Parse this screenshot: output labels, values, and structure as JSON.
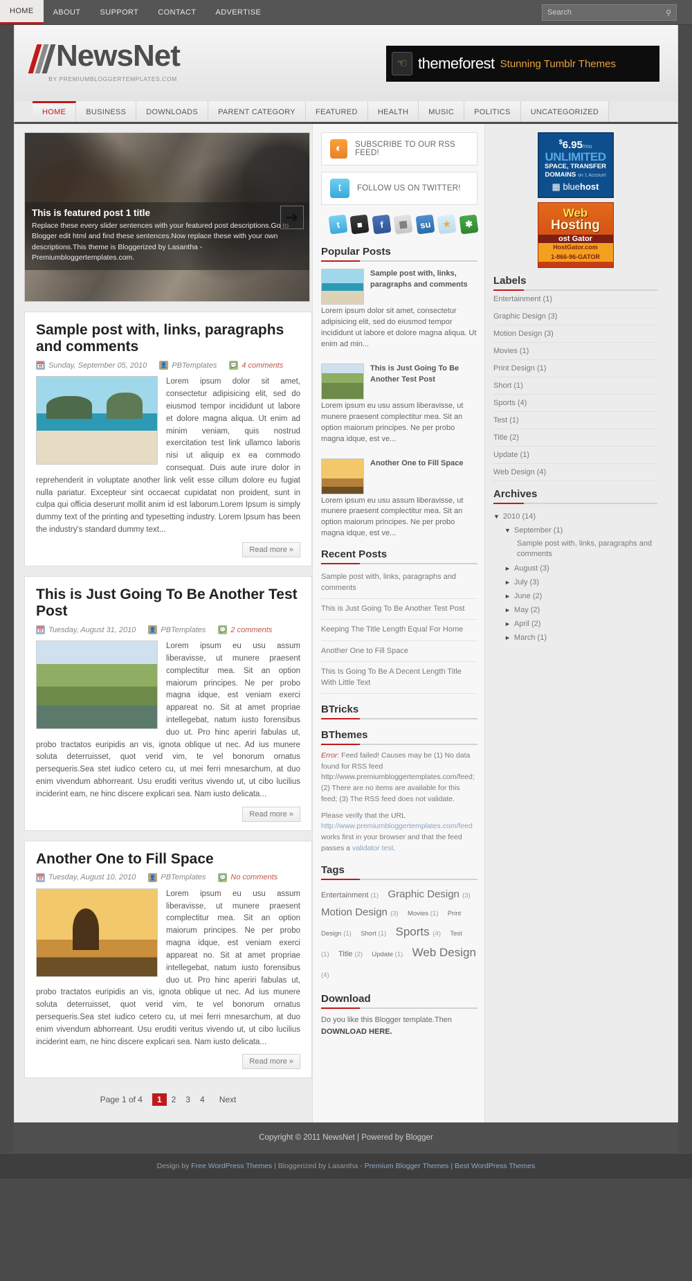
{
  "topbar": {
    "nav": [
      {
        "label": "HOME",
        "active": true
      },
      {
        "label": "ABOUT",
        "active": false
      },
      {
        "label": "SUPPORT",
        "active": false
      },
      {
        "label": "CONTACT",
        "active": false
      },
      {
        "label": "ADVERTISE",
        "active": false
      }
    ],
    "search_placeholder": "Search",
    "search_value": ""
  },
  "header": {
    "logo_name": "NewsNet",
    "logo_sub": "BY PREMIUMBLOGGERTEMPLATES.COM",
    "banner_text_1": "themeforest",
    "banner_text_2": "Stunning Tumblr Themes"
  },
  "catnav": [
    {
      "label": "HOME",
      "active": true
    },
    {
      "label": "BUSINESS",
      "active": false
    },
    {
      "label": "DOWNLOADS",
      "active": false
    },
    {
      "label": "PARENT CATEGORY",
      "active": false
    },
    {
      "label": "FEATURED",
      "active": false
    },
    {
      "label": "HEALTH",
      "active": false
    },
    {
      "label": "MUSIC",
      "active": false
    },
    {
      "label": "POLITICS",
      "active": false
    },
    {
      "label": "UNCATEGORIZED",
      "active": false
    }
  ],
  "slider": {
    "title": "This is featured post 1 title",
    "desc": "Replace these every slider sentences with your featured post descriptions.Go to Blogger edit html and find these sentences.Now replace these with your own descriptions.This theme is Bloggerized by Lasantha - Premiumbloggertemplates.com.",
    "next_label": "➔"
  },
  "posts": [
    {
      "title": "Sample post with, links, paragraphs and comments",
      "date": "Sunday, September 05, 2010",
      "author": "PBTemplates",
      "comments": "4 comments",
      "body": "Lorem ipsum dolor sit amet, consectetur adipisicing elit, sed do eiusmod tempor incididunt ut labore et dolore magna aliqua. Ut enim ad minim veniam, quis nostrud exercitation test link ullamco laboris nisi ut aliquip ex ea commodo consequat. Duis aute irure dolor in reprehenderit in voluptate another link velit esse cillum dolore eu fugiat nulla pariatur. Excepteur sint occaecat cupidatat non proident, sunt in culpa qui officia deserunt mollit anim id est laborum.Lorem Ipsum is simply dummy text of the printing and typesetting industry. Lorem Ipsum has been the industry's standard dummy text...",
      "readmore": "Read more »",
      "thumb_class": "beach"
    },
    {
      "title": "This is Just Going To Be Another Test Post",
      "date": "Tuesday, August 31, 2010",
      "author": "PBTemplates",
      "comments": "2 comments",
      "body": "Lorem ipsum eu usu assum liberavisse, ut munere praesent complectitur mea. Sit an option maiorum principes. Ne per probo magna idque, est veniam exerci appareat no. Sit at amet propriae intellegebat, natum iusto forensibus duo ut. Pro hinc aperiri fabulas ut, probo tractatos euripidis an vis, ignota oblique ut nec. Ad ius munere soluta deterruisset, quot verid vim, te vel bonorum ornatus persequeris.Sea stet iudico cetero cu, ut mei ferri mnesarchum, at duo enim vivendum abhorreant. Usu eruditi veritus vivendo ut, ut cibo lucilius inciderint eam, ne hinc discere explicari sea. Nam iusto delicata...",
      "readmore": "Read more »",
      "thumb_class": "horse"
    },
    {
      "title": "Another One to Fill Space",
      "date": "Tuesday, August 10, 2010",
      "author": "PBTemplates",
      "comments": "No comments",
      "body": "Lorem ipsum eu usu assum liberavisse, ut munere praesent complectitur mea. Sit an option maiorum principes. Ne per probo magna idque, est veniam exerci appareat no. Sit at amet propriae intellegebat, natum iusto forensibus duo ut. Pro hinc aperiri fabulas ut, probo tractatos euripidis an vis, ignota oblique ut nec. Ad ius munere soluta deterruisset, quot verid vim, te vel bonorum ornatus persequeris.Sea stet iudico cetero cu, ut mei ferri mnesarchum, at duo enim vivendum abhorreant. Usu eruditi veritus vivendo ut, ut cibo lucilius inciderint eam, ne hinc discere explicari sea. Nam iusto delicata...",
      "readmore": "Read more »",
      "thumb_class": "tree"
    }
  ],
  "pager": {
    "label": "Page 1 of 4",
    "pages": [
      "1",
      "2",
      "3",
      "4"
    ],
    "current": "1",
    "next": "Next"
  },
  "mid": {
    "rss_label": "SUBSCRIBE TO OUR RSS FEED!",
    "twitter_label": "FOLLOW US ON TWITTER!",
    "social_icons": [
      "twitter-icon",
      "delicious-icon",
      "facebook-icon",
      "reddit-icon",
      "stumbleupon-icon",
      "yahoo-buzz-icon",
      "xing-icon"
    ],
    "popular_title": "Popular Posts",
    "popular": [
      {
        "title": "Sample post with, links, paragraphs and comments",
        "excerpt": "Lorem ipsum dolor sit amet, consectetur adipisicing elit, sed do eiusmod tempor incididunt ut labore et dolore magna aliqua. Ut enim ad min...",
        "thumb": "b1"
      },
      {
        "title": "This is Just Going To Be Another Test Post",
        "excerpt": "Lorem ipsum eu usu assum liberavisse, ut munere praesent complectitur mea. Sit an option maiorum principes. Ne per probo magna idque, est ve...",
        "thumb": "b2"
      },
      {
        "title": "Another One to Fill Space",
        "excerpt": "Lorem ipsum eu usu assum liberavisse, ut munere praesent complectitur mea. Sit an option maiorum principes. Ne per probo magna idque, est ve...",
        "thumb": "b3"
      }
    ],
    "recent_title": "Recent Posts",
    "recent": [
      "Sample post with, links, paragraphs and comments",
      "This is Just Going To Be Another Test Post",
      "Keeping The Title Length Equal For Home",
      "Another One to Fill Space",
      "This Is Going To Be A Decent Length Title With Little Text"
    ],
    "btricks_title": "BTricks",
    "bthemes_title": "BThemes",
    "error_prefix": "Error:",
    "error_text": "Feed failed! Causes may be (1) No data found for RSS feed http://www.premiumbloggertemplates.com/feed; (2) There are no items are available for this feed; (3) The RSS feed does not validate.",
    "verify_text_1": "Please verify that the URL",
    "verify_url": "http://www.premiumbloggertemplates.com/feed",
    "verify_text_2": "works first in your browser and that the feed passes a",
    "verify_link": "validator test",
    "verify_text_3": ".",
    "tags_title": "Tags",
    "tags": [
      {
        "name": "Entertainment",
        "count": "(1)",
        "size": "tg1"
      },
      {
        "name": "Graphic Design",
        "count": "(3)",
        "size": "tg3"
      },
      {
        "name": "Motion Design",
        "count": "(3)",
        "size": "tg3"
      },
      {
        "name": "Movies",
        "count": "(1)",
        "size": "tg5"
      },
      {
        "name": "Print Design",
        "count": "(1)",
        "size": "tg5"
      },
      {
        "name": "Short",
        "count": "(1)",
        "size": "tg5"
      },
      {
        "name": "Sports",
        "count": "(4)",
        "size": "tg4"
      },
      {
        "name": "Test",
        "count": "(1)",
        "size": "tg5"
      },
      {
        "name": "Title",
        "count": "(2)",
        "size": "tg1"
      },
      {
        "name": "Update",
        "count": "(1)",
        "size": "tg5"
      },
      {
        "name": "Web Design",
        "count": "(4)",
        "size": "tg4"
      }
    ],
    "download_title": "Download",
    "download_text": "Do you like this Blogger template.Then",
    "download_link": "DOWNLOAD HERE."
  },
  "right": {
    "ad_blue": {
      "price_currency": "$",
      "price": "6.95",
      "price_unit": "/mo",
      "line2": "UNLIMITED",
      "line3": "SPACE, TRANSFER",
      "line4": "DOMAINS",
      "line4_small": "on 1 Account",
      "brand_1": "blue",
      "brand_2": "host"
    },
    "ad_orange": {
      "line1": "Web",
      "line2": "Hosting",
      "line3": "ost Gator",
      "line4": "HostGator.com",
      "line5": "1-866-96-GATOR"
    },
    "labels_title": "Labels",
    "labels": [
      "Entertainment (1)",
      "Graphic Design (3)",
      "Motion Design (3)",
      "Movies (1)",
      "Print Design (1)",
      "Short (1)",
      "Sports (4)",
      "Test (1)",
      "Title (2)",
      "Update (1)",
      "Web Design (4)"
    ],
    "archives_title": "Archives",
    "archives": [
      {
        "level": 1,
        "arrow": "▼",
        "label": "2010 (14)"
      },
      {
        "level": 2,
        "arrow": "▼",
        "label": "September (1)"
      },
      {
        "level": 3,
        "arrow": "",
        "label": "Sample post with, links, paragraphs and comments"
      },
      {
        "level": 2,
        "arrow": "►",
        "label": "August (3)"
      },
      {
        "level": 2,
        "arrow": "►",
        "label": "July (3)"
      },
      {
        "level": 2,
        "arrow": "►",
        "label": "June (2)"
      },
      {
        "level": 2,
        "arrow": "►",
        "label": "May (2)"
      },
      {
        "level": 2,
        "arrow": "►",
        "label": "April (2)"
      },
      {
        "level": 2,
        "arrow": "►",
        "label": "March (1)"
      }
    ]
  },
  "footer": {
    "copyright": "Copyright © 2011 NewsNet | Powered by Blogger",
    "credits_1": "Design by ",
    "credits_link_1": "Free WordPress Themes",
    "credits_2": " | Bloggerized by Lasantha - ",
    "credits_link_2": "Premium Blogger Themes",
    "credits_3": " | ",
    "credits_link_3": "Best WordPress Themes"
  }
}
